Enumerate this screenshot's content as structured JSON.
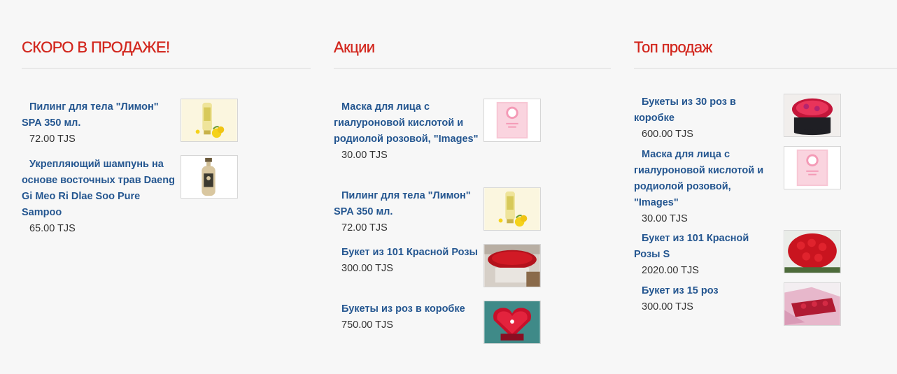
{
  "soon": {
    "title": "СКОРО В ПРОДАЖЕ!",
    "items": [
      {
        "name": "Пилинг для тела \"Лимон\" SPA 350 мл.",
        "price": "72.00 TJS",
        "image": "lemon-peeling-tube-image"
      },
      {
        "name": "Укрепляющий шампунь на основе восточных трав Daeng Gi Meo Ri Dlae Soo Pure Sampoo",
        "price": "65.00 TJS",
        "image": "shampoo-bottle-image"
      }
    ]
  },
  "sale": {
    "title": "Акции",
    "items": [
      {
        "name": "Маска для лица с гиалуроновой кислотой и родиолой розовой, \"Images\"",
        "price": "30.00 TJS",
        "image": "face-mask-image"
      },
      {
        "name": "Пилинг для тела \"Лимон\" SPA 350 мл.",
        "price": "72.00 TJS",
        "image": "lemon-peeling-tube-image"
      },
      {
        "name": "Букет из 101 Красной Розы",
        "price": "300.00 TJS",
        "image": "red-roses-bouquet-image"
      },
      {
        "name": "Букеты из роз в коробке",
        "price": "750.00 TJS",
        "image": "heart-box-roses-image"
      }
    ]
  },
  "top": {
    "title": "Топ продаж",
    "items": [
      {
        "name": "Букеты из 30 роз в коробке",
        "price": "600.00 TJS",
        "image": "roses-hatbox-image"
      },
      {
        "name": "Маска для лица с гиалуроновой кислотой и родиолой розовой, \"Images\"",
        "price": "30.00 TJS",
        "image": "face-mask-image"
      },
      {
        "name": "Букет из 101 Красной Розы S",
        "price": "2020.00 TJS",
        "image": "red-roses-bouquet-image"
      },
      {
        "name": "Букет из 15 роз",
        "price": "300.00 TJS",
        "image": "wrapped-roses-image"
      }
    ]
  }
}
